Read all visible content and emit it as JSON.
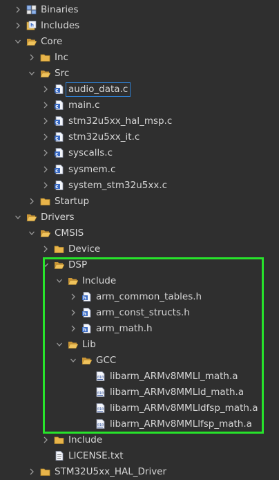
{
  "accent_highlight": "#27e42b",
  "selection_border": "#2f7fd1",
  "tree": [
    {
      "label": "Binaries",
      "depth": 0,
      "icon": "binaries-icon",
      "chevron": "right"
    },
    {
      "label": "Includes",
      "depth": 0,
      "icon": "includes-icon",
      "chevron": "right"
    },
    {
      "label": "Core",
      "depth": 0,
      "icon": "folder-open-icon",
      "chevron": "down"
    },
    {
      "label": "Inc",
      "depth": 1,
      "icon": "folder-icon",
      "chevron": "right"
    },
    {
      "label": "Src",
      "depth": 1,
      "icon": "folder-open-icon",
      "chevron": "down"
    },
    {
      "label": "audio_data.c",
      "depth": 2,
      "icon": "c-file-icon",
      "chevron": "right",
      "selected": true
    },
    {
      "label": "main.c",
      "depth": 2,
      "icon": "c-file-icon",
      "chevron": "right"
    },
    {
      "label": "stm32u5xx_hal_msp.c",
      "depth": 2,
      "icon": "c-file-icon",
      "chevron": "right"
    },
    {
      "label": "stm32u5xx_it.c",
      "depth": 2,
      "icon": "c-file-icon",
      "chevron": "right"
    },
    {
      "label": "syscalls.c",
      "depth": 2,
      "icon": "c-file-icon",
      "chevron": "right"
    },
    {
      "label": "sysmem.c",
      "depth": 2,
      "icon": "c-file-icon",
      "chevron": "right"
    },
    {
      "label": "system_stm32u5xx.c",
      "depth": 2,
      "icon": "c-file-icon",
      "chevron": "right"
    },
    {
      "label": "Startup",
      "depth": 1,
      "icon": "folder-icon",
      "chevron": "right"
    },
    {
      "label": "Drivers",
      "depth": 0,
      "icon": "folder-open-icon",
      "chevron": "down"
    },
    {
      "label": "CMSIS",
      "depth": 1,
      "icon": "folder-open-icon",
      "chevron": "down"
    },
    {
      "label": "Device",
      "depth": 2,
      "icon": "folder-icon",
      "chevron": "right"
    },
    {
      "label": "DSP",
      "depth": 2,
      "icon": "folder-open-icon",
      "chevron": "down"
    },
    {
      "label": "Include",
      "depth": 3,
      "icon": "folder-open-icon",
      "chevron": "down"
    },
    {
      "label": "arm_common_tables.h",
      "depth": 4,
      "icon": "h-file-icon",
      "chevron": "right"
    },
    {
      "label": "arm_const_structs.h",
      "depth": 4,
      "icon": "h-file-icon",
      "chevron": "right"
    },
    {
      "label": "arm_math.h",
      "depth": 4,
      "icon": "h-file-icon",
      "chevron": "right"
    },
    {
      "label": "Lib",
      "depth": 3,
      "icon": "folder-open-icon",
      "chevron": "down"
    },
    {
      "label": "GCC",
      "depth": 4,
      "icon": "folder-open-icon",
      "chevron": "down"
    },
    {
      "label": "libarm_ARMv8MMLl_math.a",
      "depth": 5,
      "icon": "archive-file-icon",
      "chevron": "none"
    },
    {
      "label": "libarm_ARMv8MMLld_math.a",
      "depth": 5,
      "icon": "archive-file-icon",
      "chevron": "none"
    },
    {
      "label": "libarm_ARMv8MMLldfsp_math.a",
      "depth": 5,
      "icon": "archive-file-icon",
      "chevron": "none"
    },
    {
      "label": "libarm_ARMv8MMLlfsp_math.a",
      "depth": 5,
      "icon": "archive-file-icon",
      "chevron": "none"
    },
    {
      "label": "Include",
      "depth": 2,
      "icon": "folder-icon",
      "chevron": "right"
    },
    {
      "label": "LICENSE.txt",
      "depth": 2,
      "icon": "text-file-icon",
      "chevron": "none"
    },
    {
      "label": "STM32U5xx_HAL_Driver",
      "depth": 1,
      "icon": "folder-icon",
      "chevron": "right"
    }
  ]
}
